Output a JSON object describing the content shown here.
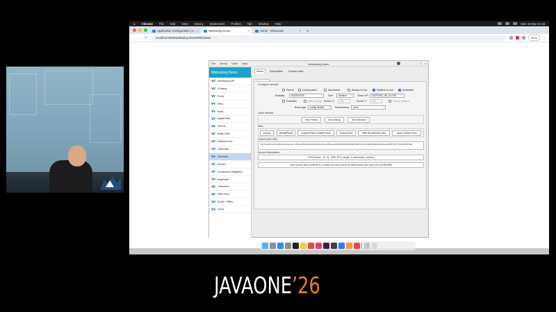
{
  "macos": {
    "app_name": "Chrome",
    "menus": [
      "File",
      "Edit",
      "View",
      "History",
      "Bookmarks",
      "Profiles",
      "Tab",
      "Window",
      "Help"
    ],
    "clock": "Mon 16 Mar 11:16"
  },
  "browser": {
    "tabs": [
      {
        "label": "Application Configuration | A...",
        "active": false
      },
      {
        "label": "Webswing Demo",
        "active": true
      },
      {
        "label": "Home - Showcase",
        "active": false
      }
    ],
    "new_tab": "+",
    "url": "localhost:4040/webswing-demo/#Windows",
    "profile_button": "Work"
  },
  "app": {
    "window_title": "Webswing Demo",
    "menus": [
      "File",
      "Demo",
      "View",
      "Help"
    ],
    "brand": "Webswing Demo",
    "sidebar_items": [
      "Webswing API",
      "Printing",
      "Fonts",
      "Files",
      "Input",
      "Applet Info",
      "JSLink",
      "Basic DnD",
      "Plateau DnD",
      "Clipboard",
      "Windows",
      "Screen",
      "Component Migration",
      "Keyboard",
      "Timezone",
      "Web View",
      "Audio / Video",
      "JOGL"
    ],
    "active_item": "Windows",
    "content_tabs": [
      "Demo",
      "Description",
      "Source code"
    ],
    "inner_tab": "Windows",
    "configure": {
      "title": "Configure window",
      "checkboxes": [
        {
          "label": "Parent",
          "checked": false
        },
        {
          "label": "Undecorated",
          "checked": false
        },
        {
          "label": "Maximized",
          "checked": false
        },
        {
          "label": "Always on top",
          "checked": false
        },
        {
          "label": "Relative to null",
          "checked": true
        },
        {
          "label": "Resizable",
          "checked": true
        }
      ],
      "modality_label": "Modality",
      "modality_value": "MODELESS",
      "size_label": "Size",
      "size_value": "medium",
      "close_op_label": "Close OP",
      "close_op_value": "DISPOSE_ON_CLOSE",
      "dockable_label": "Dockable",
      "autoundock_label": "Auto undock",
      "screen_x_label": "Screen X",
      "screen_x_value": "100",
      "screen_y_label": "Screen Y",
      "screen_y_value": "100",
      "screen_relative_label": "Screen relative",
      "book_type_label": "Book type",
      "book_type_value": "config default",
      "translucency_label": "Translucency",
      "translucency_value": "none"
    },
    "open_window": {
      "title": "Open window",
      "buttons": [
        "new Frame",
        "new Dialog",
        "new Window"
      ]
    },
    "misc": {
      "title": "Misc",
      "buttons": [
        "popup",
        "defaultPanel",
        "JOptionPane.createFrame",
        "Undock test",
        "Hide all windows (5s)",
        "Open Linked View"
      ]
    },
    "linked_view": {
      "title": "Linked View URL",
      "value": "http://localhost:4040/webswing-demo/?linkedView&id=d25e0c9e4b4e-25f-peaks89f7d6b25004b3jb15d6fVFsm9Ag3A63MlOiMg4e1uqz4BFTkOl7?wsfVqHNOE8"
    },
    "screen_info": {
      "title": "Screen information",
      "line1": "THIS screen - [0, 0], 1496, 871], single: 0, landscape, primary",
      "line2": "User screen size [1496x871] Location on user screen [0,38] Browser win outer size [1496x980]"
    }
  },
  "dock": {
    "icons": [
      "finder-icon",
      "launchpad-icon",
      "safari-icon",
      "settings-icon",
      "terminal-icon",
      "notes-icon",
      "chrome-icon",
      "intellij-icon",
      "slack-icon",
      "activity-icon",
      "keynote-icon",
      "photos-icon",
      "preview-icon",
      "downloads-icon",
      "trash-icon"
    ],
    "colors": [
      "#5ab0f0",
      "#8a8fa5",
      "#2e8de8",
      "#8c8c94",
      "#222222",
      "#f2c94c",
      "#e84a3c",
      "#e5456b",
      "#4a154b",
      "#3d3d3d",
      "#3478f6",
      "#f59b42",
      "#e24b4b",
      "#c6c6c6",
      "#d9d9d9"
    ]
  },
  "branding": {
    "event_name": "JAVAONE",
    "event_year": "’26",
    "accent_color": "#e8821e"
  }
}
